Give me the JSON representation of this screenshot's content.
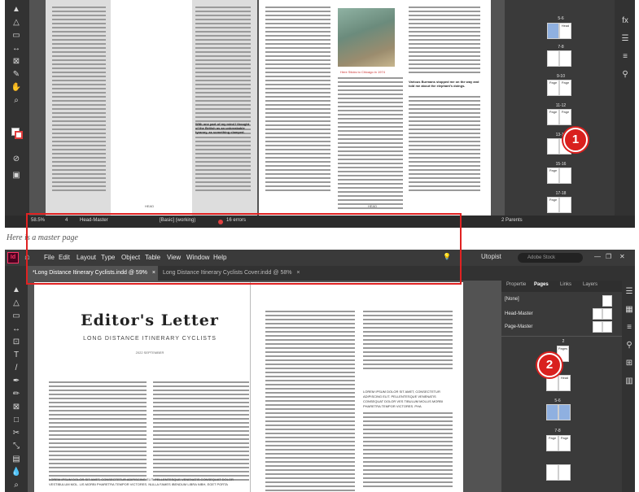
{
  "top_screenshot": {
    "status": {
      "zoom": "58.5%",
      "page_number": "4",
      "master": "Head-Master",
      "preflight_profile": "[Basic] (working)",
      "errors": "16 errors"
    },
    "pages_panel": {
      "spreads": [
        "5-6",
        "7-8",
        "9-10",
        "11-12",
        "13-14",
        "15-16",
        "17-18"
      ],
      "page_labels": [
        "Head",
        "Page",
        "Page",
        "Page",
        "Page",
        "Page",
        "Page"
      ],
      "footer": "2 Parents"
    },
    "document": {
      "page_headings": [
        "HEAD",
        "HEAD"
      ],
      "photo_caption": "Here Sticks to Chicago in 1974",
      "bold_lead_left": "With one part of my mind I thought of the British as an unbreakable tyranny, as something clamped.",
      "bold_lead_right": "Various Burmans stopped me on the way and told me about the elephant's doings."
    },
    "callout": "1"
  },
  "caption": "Here is a master page",
  "bottom_screenshot": {
    "menu": [
      "File",
      "Edit",
      "Layout",
      "Type",
      "Object",
      "Table",
      "View",
      "Window",
      "Help"
    ],
    "app_logo": "Id",
    "workspace": "Utopist",
    "search_placeholder": "Adobe Stock",
    "tabs": [
      {
        "label": "*Long Distance Itinerary Cyclists.indd @ 59%",
        "close": "×"
      },
      {
        "label": "Long Distance Itinerary Cyclists Cover.indd @ 58%",
        "close": "×"
      }
    ],
    "document": {
      "title": "Editor's Letter",
      "subtitle": "LONG DISTANCE ITINERARY CYCLISTS",
      "date": "2022 SEPTEMBER",
      "lorem_caps_left": "LOREM IPSUM DOLOR SIT AMET, CONSECTETUR ADIPISCING ELIT. PELLENTESQUE VENENATIS CONSEQUAT DOLOR VESTIBULUM MOL. LIS MORBI PHARETRA TEMPOR VICTORES. NULLA FAMES IBENDUM LIBRA NIBH, EGET PORTA",
      "lorem_caps_right": "LOREM IPSUM DOLOR SIT AMET, CONSECTETUR ADIPISCING ELIT. PELLENTESQUE VENENATIS CONSEQUAT DOLOR VES TIBULUM MOLLIS MORBI PHARETRA TEMPOR VICTORES. PHA"
    },
    "panel": {
      "tabs": [
        "Propertie",
        "Pages",
        "Links",
        "Layers"
      ],
      "masters": [
        "[None]",
        "Head-Master",
        "Page-Master"
      ],
      "spreads": [
        "2",
        "3-4",
        "5-6",
        "7-8"
      ],
      "page_labels": [
        "Pages",
        "Head",
        "Page",
        "Page"
      ]
    },
    "callout": "2"
  },
  "colors": {
    "accent_red": "#e02222",
    "ui_dark": "#323232",
    "ui_mid": "#535353"
  }
}
